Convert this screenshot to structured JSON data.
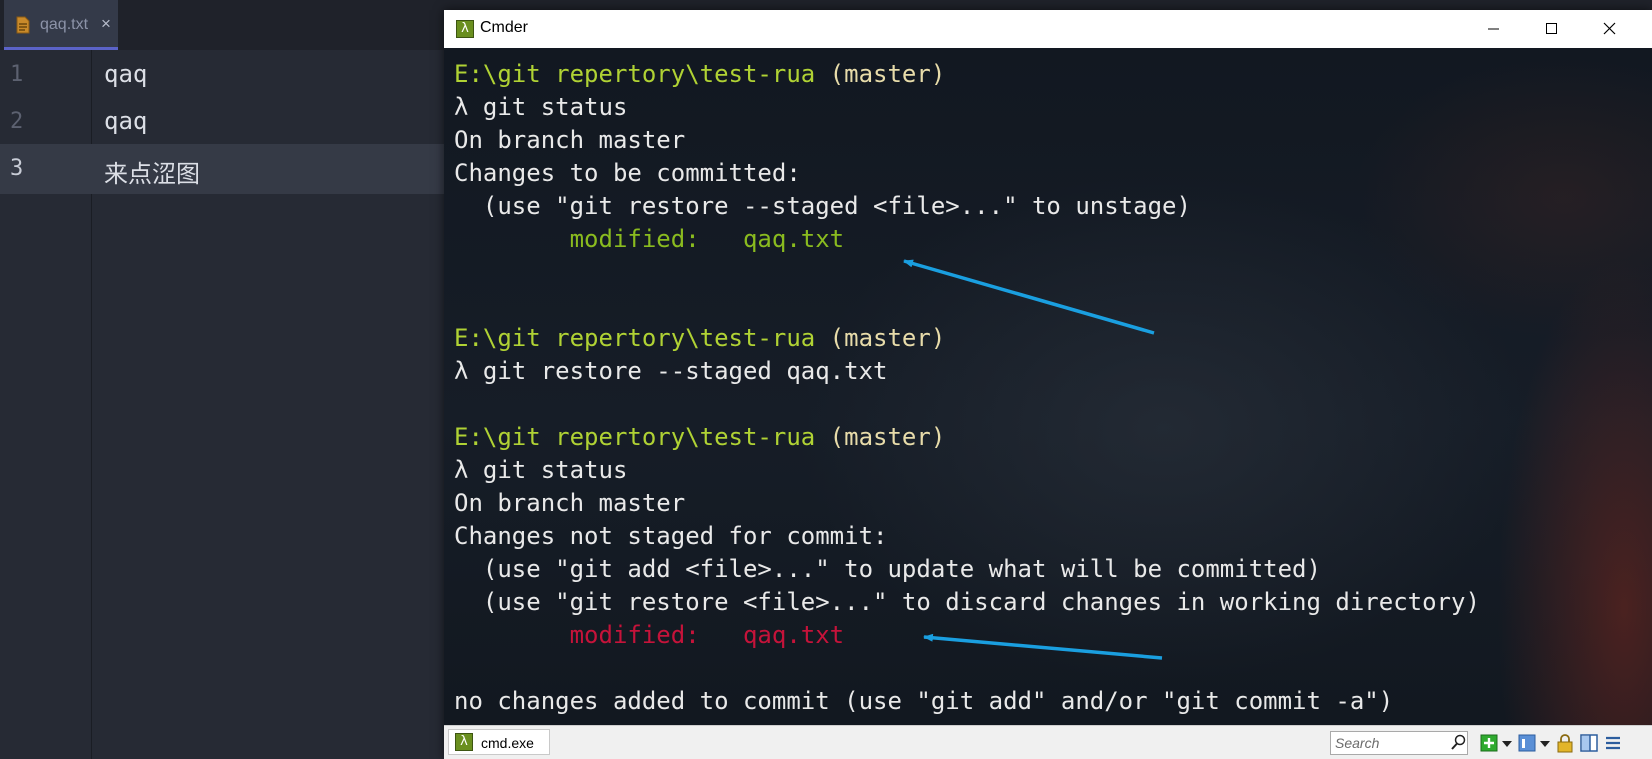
{
  "editor": {
    "tab": {
      "title": "qaq.txt",
      "close_glyph": "×",
      "icon": "text-file-icon"
    },
    "lines": [
      {
        "number": "1",
        "text": "qaq"
      },
      {
        "number": "2",
        "text": "qaq"
      },
      {
        "number": "3",
        "text": "来点涩图"
      }
    ],
    "current_line": 3
  },
  "cmder": {
    "window_title": "Cmder",
    "app_icon": "lambda-icon",
    "app_icon_glyph": "λ",
    "controls": [
      "minimize-icon",
      "maximize-icon",
      "close-icon"
    ],
    "terminal": [
      [
        {
          "t": "E:\\git repertory\\test-rua",
          "c": "prompt-path"
        },
        {
          "t": " (master)",
          "c": "prompt-branch"
        }
      ],
      [
        {
          "t": "λ git status"
        }
      ],
      [
        {
          "t": "On branch master"
        }
      ],
      [
        {
          "t": "Changes to be committed:"
        }
      ],
      [
        {
          "t": "  (use \"git restore --staged <file>...\" to unstage)"
        }
      ],
      [
        {
          "t": "        "
        },
        {
          "t": "modified:   qaq.txt",
          "c": "staged"
        }
      ],
      [],
      [],
      [
        {
          "t": "E:\\git repertory\\test-rua",
          "c": "prompt-path"
        },
        {
          "t": " (master)",
          "c": "prompt-branch"
        }
      ],
      [
        {
          "t": "λ git restore --staged qaq.txt"
        }
      ],
      [],
      [
        {
          "t": "E:\\git repertory\\test-rua",
          "c": "prompt-path"
        },
        {
          "t": " (master)",
          "c": "prompt-branch"
        }
      ],
      [
        {
          "t": "λ git status"
        }
      ],
      [
        {
          "t": "On branch master"
        }
      ],
      [
        {
          "t": "Changes not staged for commit:"
        }
      ],
      [
        {
          "t": "  (use \"git add <file>...\" to update what will be committed)"
        }
      ],
      [
        {
          "t": "  (use \"git restore <file>...\" to discard changes in working directory)"
        }
      ],
      [
        {
          "t": "        "
        },
        {
          "t": "modified:   qaq.txt",
          "c": "unstaged"
        }
      ],
      [],
      [
        {
          "t": "no changes added to commit (use \"git add\" and/or \"git commit -a\")"
        }
      ]
    ],
    "annotations": [
      "arrow-icon",
      "arrow-icon"
    ],
    "colors": {
      "prompt_path": "#b0d234",
      "prompt_branch": "#e8dcaa",
      "staged": "#8abb1f",
      "unstaged": "#c5133a",
      "arrow": "#1a9fe0"
    },
    "statusbar": {
      "console_tab_label": "cmd.exe",
      "search_placeholder": "Search",
      "icons": [
        "new-console-icon",
        "dropdown-icon",
        "view-icon",
        "dropdown-icon",
        "lock-icon",
        "split-panes-icon",
        "menu-icon"
      ]
    }
  }
}
